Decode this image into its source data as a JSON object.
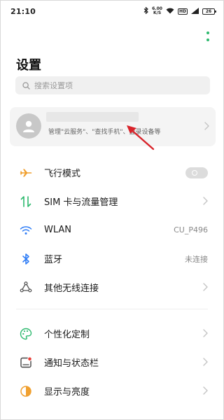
{
  "status_bar": {
    "time": "21:10",
    "speed_value": "6.00",
    "speed_unit": "K/S",
    "network_badge": "HD",
    "battery": "26"
  },
  "header": {
    "title": "设置",
    "search_placeholder": "搜索设置项"
  },
  "account": {
    "description": "管理\"云服务\"、\"查找手机\"、登录设备等"
  },
  "group1": [
    {
      "label": "飞行模式",
      "icon": "airplane-icon",
      "control": "toggle",
      "toggle_on": false
    },
    {
      "label": "SIM 卡与流量管理",
      "icon": "sim-data-icon"
    },
    {
      "label": "WLAN",
      "icon": "wifi-icon",
      "value": "CU_P496"
    },
    {
      "label": "蓝牙",
      "icon": "bluetooth-icon",
      "value": "未连接"
    },
    {
      "label": "其他无线连接",
      "icon": "connections-icon"
    }
  ],
  "group2": [
    {
      "label": "个性化定制",
      "icon": "palette-icon"
    },
    {
      "label": "通知与状态栏",
      "icon": "notification-icon"
    },
    {
      "label": "显示与亮度",
      "icon": "brightness-icon"
    }
  ],
  "colors": {
    "accent_green": "#2db96e",
    "airplane": "#f0a030",
    "blue": "#2f7df6",
    "danger_red": "#e8403a",
    "arrow_red": "#d8232a"
  }
}
